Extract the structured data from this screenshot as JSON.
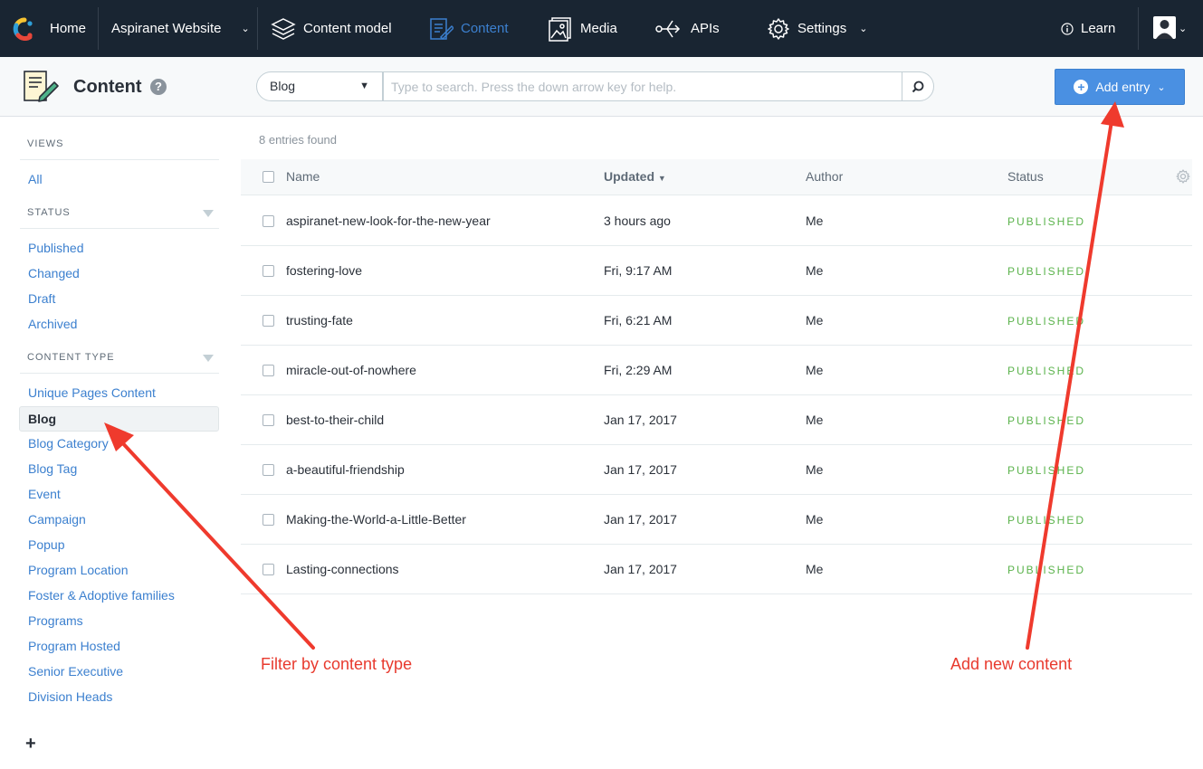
{
  "topnav": {
    "home": "Home",
    "space": "Aspiranet Website",
    "content_model": "Content model",
    "content": "Content",
    "media": "Media",
    "apis": "APIs",
    "settings": "Settings",
    "learn": "Learn"
  },
  "header": {
    "title": "Content",
    "content_type_select": "Blog",
    "search_placeholder": "Type to search. Press the down arrow key for help.",
    "add_entry": "Add entry"
  },
  "sidebar": {
    "views_heading": "VIEWS",
    "views": [
      "All"
    ],
    "status_heading": "STATUS",
    "status": [
      "Published",
      "Changed",
      "Draft",
      "Archived"
    ],
    "content_type_heading": "CONTENT TYPE",
    "content_types": [
      "Unique Pages Content",
      "Blog",
      "Blog Category",
      "Blog Tag",
      "Event",
      "Campaign",
      "Popup",
      "Program Location",
      "Foster & Adoptive families",
      "Programs",
      "Program Hosted",
      "Senior Executive",
      "Division Heads"
    ],
    "selected_content_type": "Blog"
  },
  "table": {
    "entries_found": "8 entries found",
    "columns": [
      "Name",
      "Updated",
      "Author",
      "Status"
    ],
    "rows": [
      {
        "name": "aspiranet-new-look-for-the-new-year",
        "updated": "3 hours ago",
        "author": "Me",
        "status": "PUBLISHED"
      },
      {
        "name": "fostering-love",
        "updated": "Fri, 9:17 AM",
        "author": "Me",
        "status": "PUBLISHED"
      },
      {
        "name": "trusting-fate",
        "updated": "Fri, 6:21 AM",
        "author": "Me",
        "status": "PUBLISHED"
      },
      {
        "name": "miracle-out-of-nowhere",
        "updated": "Fri, 2:29 AM",
        "author": "Me",
        "status": "PUBLISHED"
      },
      {
        "name": "best-to-their-child",
        "updated": "Jan 17, 2017",
        "author": "Me",
        "status": "PUBLISHED"
      },
      {
        "name": "a-beautiful-friendship",
        "updated": "Jan 17, 2017",
        "author": "Me",
        "status": "PUBLISHED"
      },
      {
        "name": "Making-the-World-a-Little-Better",
        "updated": "Jan 17, 2017",
        "author": "Me",
        "status": "PUBLISHED"
      },
      {
        "name": "Lasting-connections",
        "updated": "Jan 17, 2017",
        "author": "Me",
        "status": "PUBLISHED"
      }
    ]
  },
  "annotations": {
    "filter": "Filter by content type",
    "add": "Add new content"
  },
  "colors": {
    "nav_bg": "#192532",
    "accent": "#3c80cf",
    "button": "#4a90e2",
    "published": "#5bb34c",
    "annotation": "#e83a2e"
  }
}
